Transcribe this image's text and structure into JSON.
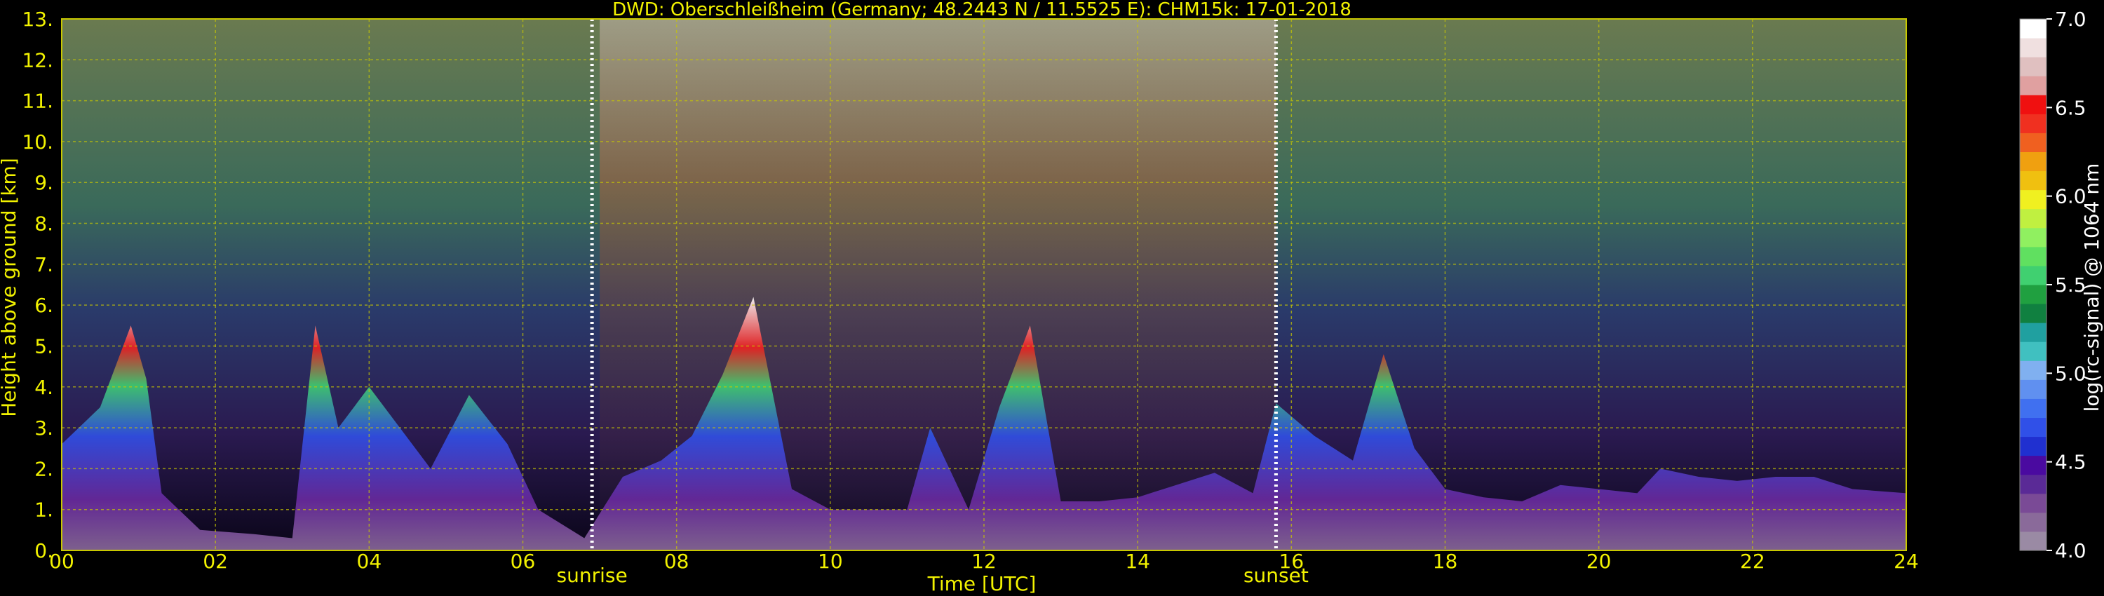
{
  "chart_data": {
    "type": "heatmap",
    "title": "DWD: Oberschleißheim (Germany; 48.2443 N / 11.5525 E):    CHM15k: 17-01-2018",
    "xlabel": "Time [UTC]",
    "ylabel": "Height above ground [km]",
    "xlim": [
      0,
      24
    ],
    "ylim": [
      0,
      13
    ],
    "x_ticks": [
      "00",
      "02",
      "04",
      "06",
      "08",
      "10",
      "12",
      "14",
      "16",
      "18",
      "20",
      "22",
      "24"
    ],
    "y_ticks": [
      "0.",
      "1.",
      "2.",
      "3.",
      "4.",
      "5.",
      "6.",
      "7.",
      "8.",
      "9.",
      "10.",
      "11.",
      "12.",
      "13."
    ],
    "grid": true,
    "annotations": [
      {
        "text": "sunrise",
        "x": 6.9
      },
      {
        "text": "sunset",
        "x": 15.8
      }
    ],
    "colorbar": {
      "label": "log(rc-signal) @ 1064 nm",
      "range": [
        4.0,
        7.0
      ],
      "ticks": [
        "4.0",
        "4.5",
        "5.0",
        "5.5",
        "6.0",
        "6.5",
        "7.0"
      ],
      "colors": [
        "#9a8aa4",
        "#8a6a9a",
        "#7a4a96",
        "#5a2a96",
        "#4a0aa0",
        "#2030d0",
        "#3050e8",
        "#4070f0",
        "#6090f0",
        "#80b0f0",
        "#40c0c0",
        "#20a0a0",
        "#108040",
        "#20a040",
        "#40d070",
        "#60e060",
        "#90f060",
        "#c0f040",
        "#f0f020",
        "#f0c010",
        "#f0a010",
        "#f06020",
        "#f03020",
        "#f01010",
        "#e0a0a0",
        "#e0c0c0",
        "#f0e0e0",
        "#ffffff"
      ]
    },
    "boundary_layer": [
      [
        0.0,
        2.6
      ],
      [
        0.5,
        3.5
      ],
      [
        0.9,
        5.5
      ],
      [
        1.1,
        4.2
      ],
      [
        1.3,
        1.4
      ],
      [
        1.8,
        0.5
      ],
      [
        2.5,
        0.4
      ],
      [
        3.0,
        0.3
      ],
      [
        3.3,
        5.5
      ],
      [
        3.6,
        3.0
      ],
      [
        4.0,
        4.0
      ],
      [
        4.4,
        3.0
      ],
      [
        4.8,
        2.0
      ],
      [
        5.3,
        3.8
      ],
      [
        5.8,
        2.6
      ],
      [
        6.2,
        1.0
      ],
      [
        6.8,
        0.3
      ],
      [
        7.3,
        1.8
      ],
      [
        7.8,
        2.2
      ],
      [
        8.2,
        2.8
      ],
      [
        8.6,
        4.3
      ],
      [
        9.0,
        6.2
      ],
      [
        9.5,
        1.5
      ],
      [
        10.0,
        1.0
      ],
      [
        10.5,
        1.0
      ],
      [
        11.0,
        1.0
      ],
      [
        11.3,
        3.0
      ],
      [
        11.8,
        1.0
      ],
      [
        12.2,
        3.5
      ],
      [
        12.6,
        5.5
      ],
      [
        13.0,
        1.2
      ],
      [
        13.5,
        1.2
      ],
      [
        14.0,
        1.3
      ],
      [
        14.5,
        1.6
      ],
      [
        15.0,
        1.9
      ],
      [
        15.5,
        1.4
      ],
      [
        15.8,
        3.6
      ],
      [
        16.3,
        2.8
      ],
      [
        16.8,
        2.2
      ],
      [
        17.2,
        4.8
      ],
      [
        17.6,
        2.5
      ],
      [
        18.0,
        1.5
      ],
      [
        18.5,
        1.3
      ],
      [
        19.0,
        1.2
      ],
      [
        19.5,
        1.6
      ],
      [
        20.0,
        1.5
      ],
      [
        20.5,
        1.4
      ],
      [
        20.8,
        2.0
      ],
      [
        21.3,
        1.8
      ],
      [
        21.8,
        1.7
      ],
      [
        22.3,
        1.8
      ],
      [
        22.8,
        1.8
      ],
      [
        23.3,
        1.5
      ],
      [
        24.0,
        1.4
      ]
    ]
  }
}
